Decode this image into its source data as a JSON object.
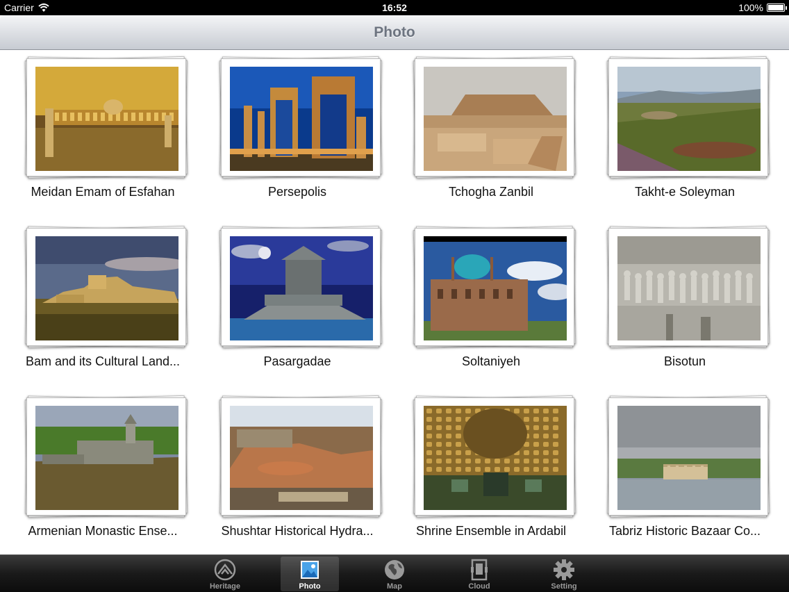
{
  "status_bar": {
    "carrier": "Carrier",
    "time": "16:52",
    "battery": "100%"
  },
  "nav": {
    "title": "Photo"
  },
  "photos": [
    {
      "caption": "Meidan Emam of Esfahan",
      "scene": "square"
    },
    {
      "caption": "Persepolis",
      "scene": "persepolis"
    },
    {
      "caption": "Tchogha Zanbil",
      "scene": "ziggurat"
    },
    {
      "caption": "Takht-e Soleyman",
      "scene": "valley"
    },
    {
      "caption": "Bam and its Cultural Land...",
      "scene": "citadel"
    },
    {
      "caption": "Pasargadae",
      "scene": "tomb"
    },
    {
      "caption": "Soltaniyeh",
      "scene": "dome"
    },
    {
      "caption": "Bisotun",
      "scene": "relief"
    },
    {
      "caption": "Armenian Monastic Ense...",
      "scene": "monastery"
    },
    {
      "caption": "Shushtar Historical Hydra...",
      "scene": "hydraulic"
    },
    {
      "caption": "Shrine Ensemble in Ardabil",
      "scene": "shrine"
    },
    {
      "caption": "Tabriz Historic Bazaar Co...",
      "scene": "lake"
    }
  ],
  "tabs": [
    {
      "label": "Heritage",
      "icon": "heritage-icon",
      "active": false
    },
    {
      "label": "Photo",
      "icon": "photo-icon",
      "active": true
    },
    {
      "label": "Map",
      "icon": "globe-icon",
      "active": false
    },
    {
      "label": "Cloud",
      "icon": "cloud-icon",
      "active": false
    },
    {
      "label": "Setting",
      "icon": "gear-icon",
      "active": false
    }
  ]
}
